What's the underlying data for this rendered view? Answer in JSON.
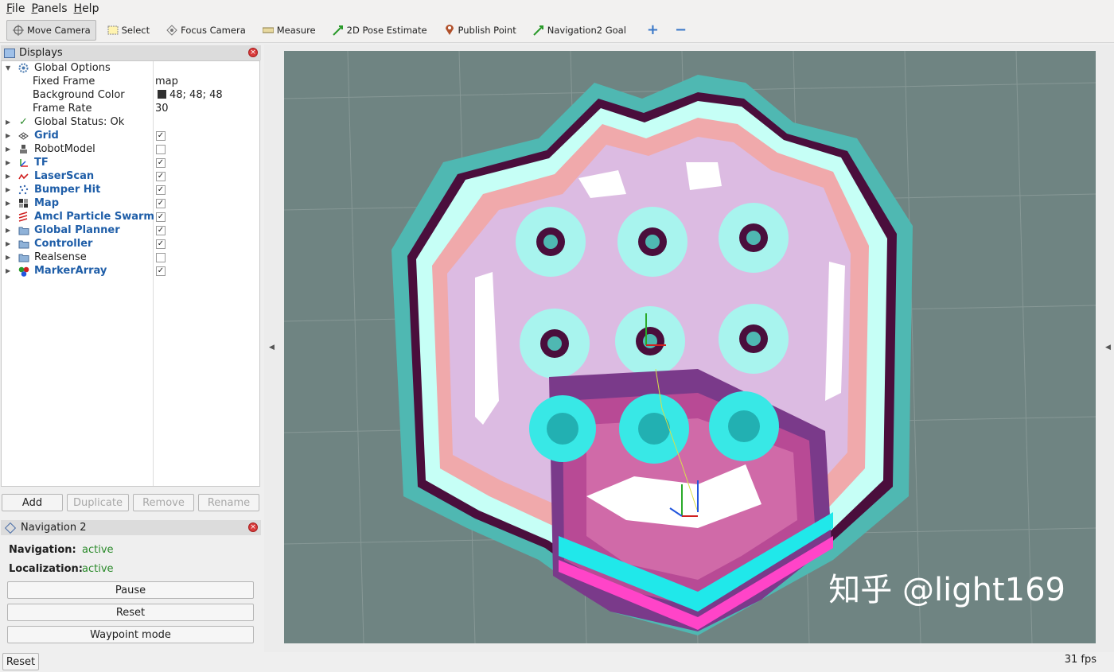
{
  "menu": [
    "File",
    "Panels",
    "Help"
  ],
  "menu_underline": [
    "F",
    "P",
    "H"
  ],
  "menu_rest": [
    "ile",
    "anels",
    "elp"
  ],
  "toolbar": {
    "tools": [
      {
        "label": "Move Camera",
        "icon": "move-camera-icon"
      },
      {
        "label": "Select",
        "icon": "select-icon"
      },
      {
        "label": "Focus Camera",
        "icon": "focus-camera-icon"
      },
      {
        "label": "Measure",
        "icon": "ruler-icon"
      },
      {
        "label": "2D Pose Estimate",
        "icon": "green-arrow-icon"
      },
      {
        "label": "Publish Point",
        "icon": "map-pin-icon"
      },
      {
        "label": "Navigation2 Goal",
        "icon": "green-arrow-icon"
      }
    ],
    "plus": "+",
    "minus": "−"
  },
  "displays": {
    "title": "Displays",
    "global_options": "Global Options",
    "fixed_frame_label": "Fixed Frame",
    "fixed_frame_value": "map",
    "bg_color_label": "Background Color",
    "bg_color_value": "48; 48; 48",
    "bg_color_hex": "#303030",
    "frame_rate_label": "Frame Rate",
    "frame_rate_value": "30",
    "global_status": "Global Status: Ok",
    "items": [
      {
        "label": "Grid",
        "checked": true,
        "blue": true
      },
      {
        "label": "RobotModel",
        "checked": false,
        "blue": false
      },
      {
        "label": "TF",
        "checked": true,
        "blue": true
      },
      {
        "label": "LaserScan",
        "checked": true,
        "blue": true
      },
      {
        "label": "Bumper Hit",
        "checked": true,
        "blue": true
      },
      {
        "label": "Map",
        "checked": true,
        "blue": true
      },
      {
        "label": "Amcl Particle Swarm",
        "checked": true,
        "blue": true
      },
      {
        "label": "Global Planner",
        "checked": true,
        "blue": true
      },
      {
        "label": "Controller",
        "checked": true,
        "blue": true
      },
      {
        "label": "Realsense",
        "checked": false,
        "blue": false
      },
      {
        "label": "MarkerArray",
        "checked": true,
        "blue": true
      }
    ],
    "buttons": {
      "add": "Add",
      "duplicate": "Duplicate",
      "remove": "Remove",
      "rename": "Rename"
    }
  },
  "navigation": {
    "title": "Navigation 2",
    "nav_label": "Navigation:",
    "nav_value": "active",
    "loc_label": "Localization:",
    "loc_value": "active",
    "pause": "Pause",
    "reset": "Reset",
    "waypoint": "Waypoint mode"
  },
  "status": {
    "reset": "Reset",
    "fps": "31 fps"
  },
  "watermark": "知乎 @light169"
}
